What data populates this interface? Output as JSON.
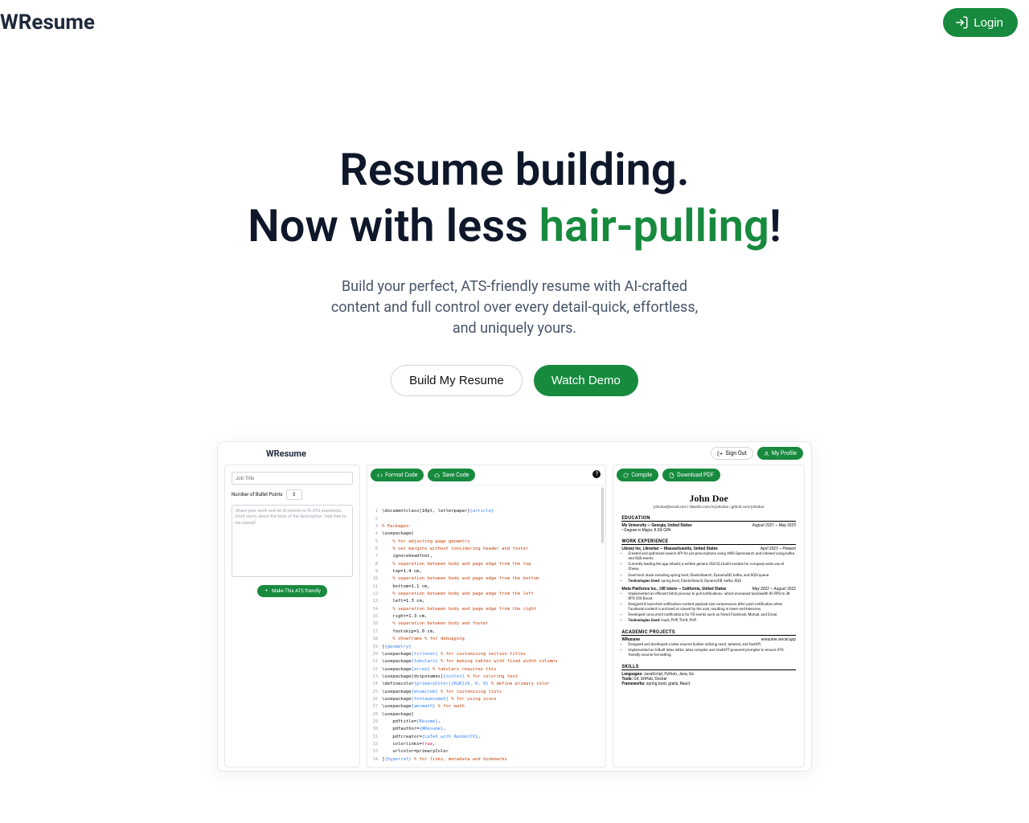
{
  "header": {
    "brand": "WResume",
    "login": "Login"
  },
  "hero": {
    "line1": "Resume building.",
    "line2_pre": "Now with less ",
    "line2_accent": "hair-pulling",
    "line2_post": "!",
    "sub": "Build your perfect, ATS-friendly resume with AI-crafted content and full control over every detail-quick, effortless, and uniquely yours.",
    "cta_primary": "Build My Resume",
    "cta_secondary": "Watch Demo"
  },
  "product": {
    "brand": "WResume",
    "signout": "Sign Out",
    "myprofile": "My Profile",
    "left": {
      "job_title_placeholder": "Job Title",
      "bullet_label": "Number of Bullet Points",
      "bullet_value": "3",
      "share_placeholder": "Share your work and let AI rewrite to fit ATS standards. Dont worry about the tone of the description. Feel free to be casual!",
      "ats_btn": "Make This ATS friendly"
    },
    "mid": {
      "format": "Format Code",
      "save": "Save Code",
      "help": "?",
      "code": [
        "\\documentclass[10pt, letterpaper]{article}",
        "",
        "% Packages:",
        "\\usepackage[",
        "    % for adjusting page geometry",
        "    % set margins without considering header and footer",
        "    ignoreheadfoot,",
        "    % separation between body and page edge from the top",
        "    top=1.4 cm,",
        "    % separation between body and page edge from the bottom",
        "    bottom=1.1 cm,",
        "    % separation between body and page edge from the left",
        "    left=1.3 cm,",
        "    % separation between body and page edge from the right",
        "    right=1.3 cm,",
        "    % separation between body and footer",
        "    footskip=1.0 cm,",
        "    % showframe % for debugging",
        "]{geometry}",
        "\\usepackage{titlesec} % for customizing section titles",
        "\\usepackage{tabularx} % for making tables with fixed width columns",
        "\\usepackage{array} % tabularx requires this",
        "\\usepackage[dvipsnames]{xcolor} % for coloring text",
        "\\definecolor{primaryColor}{RGB}{0, 0, 0} % define primary color",
        "\\usepackage{enumitem} % for customizing lists",
        "\\usepackage{fontawesome5} % for using icons",
        "\\usepackage{amsmath} % for math",
        "\\usepackage[",
        "    pdftitle={Resume},",
        "    pdfauthor={WResume},",
        "    pdfcreator={LaTeX with RenderCV},",
        "    colorlinks=true,",
        "    urlcolor=primaryColor",
        "]{hyperref} % for links, metadata and bookmarks"
      ]
    },
    "right": {
      "compile": "Compile",
      "download": "Download PDF",
      "name": "John Doe",
      "contact": "johndoe@email.com  |  linkedin.com/in/johndoe  |  github.com/johndoe",
      "edu_title": "EDUCATION",
      "edu_school": "My University — Georgia, United States",
      "edu_date": "August 2021 – May 2025",
      "edu_degree": "• Degree in Major, X.XX GPA",
      "work_title": "WORK EXPERIENCE",
      "work1_role": "Library Inc, Librarian — Massachusetts, United States",
      "work1_date": "April 2023 – Present",
      "work1_b1": "Created and optimized search API for pre-prescriptions using AWS Opensearch and indexed using kafka and SQS events.",
      "work1_b2": "Currently leading the app rebuild; a written generic GUI/CLI build module for company-wide use at Chewy.",
      "work1_b3": "Used tech stack including spring boot, ElasticSearch, DynamoDB, kafka, and SQS/queue.",
      "work1_tech_label": "Technologies Used:",
      "work1_tech": " spring boot, ElasticSearch, DynamoDB, kafka, SQS",
      "work2_role": "Meta Platforms Inc., UIE Intern — California, United States",
      "work2_date": "May 2022 – August 2022",
      "work2_b1": "Implemented an efficient fetch process to pull notifications. which increased bandwidth 90 RPS to 3K RPS 35X Boost.",
      "work2_b2": "Designed & launched notification content payload size compression after push notification when Facebook content is archived or closed by the user, resulting in lower end-latencies.",
      "work2_b3": "Developed concurrent notifications for FB events such as friend Facebook, Mutual, and Email.",
      "work2_tech_label": "Technologies Used:",
      "work2_tech": " Hack, PHP, Thrift, PHP",
      "proj_title": "ACADEMIC PROJECTS",
      "proj_name": "WResume",
      "proj_link": "wresume.vercel.app",
      "proj_b1": "Designed and developed a latex resume builder utilizing react, tailwind, and fastAPI.",
      "proj_b2": "Implemented an InBuilt latex editor, latex compiler and chatGPT-powered prompter to ensure ATS-friendly resume formatting.",
      "skills_title": "SKILLS",
      "skills_lang_label": "Languages:",
      "skills_lang": " JavaScript, Python, Java, Go",
      "skills_tools_label": "Tools:",
      "skills_tools": " Git, GitHub, Docker",
      "skills_fw_label": "Frameworks:",
      "skills_fw": " spring boot, grails, React"
    }
  }
}
